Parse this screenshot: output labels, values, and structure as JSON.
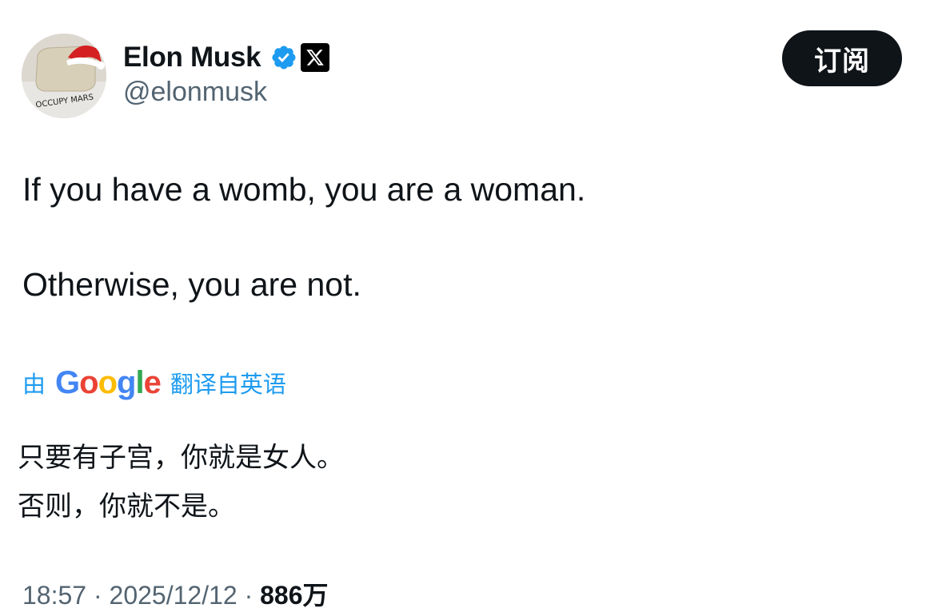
{
  "profile": {
    "display_name": "Elon Musk",
    "handle": "@elonmusk",
    "verified_icon": "verified-badge-icon",
    "affiliation_icon": "x-logo-icon",
    "avatar_text": "OCCUPY MARS"
  },
  "actions": {
    "subscribe_label": "订阅"
  },
  "tweet": {
    "line1": "If you have a womb, you are a woman.",
    "line2": "Otherwise, you are not."
  },
  "translation": {
    "prefix": "由",
    "provider": "Google",
    "suffix": "翻译自英语",
    "line1": "只要有子宫，你就是女人。",
    "line2": "否则，你就不是。"
  },
  "meta": {
    "time_date": "18:57 · 2025/12/12 · ",
    "views": "886万"
  },
  "colors": {
    "text": "#0f1419",
    "secondary": "#536471",
    "link": "#1d9bf0",
    "verified": "#1d9bf0",
    "button_bg": "#0f1419"
  }
}
